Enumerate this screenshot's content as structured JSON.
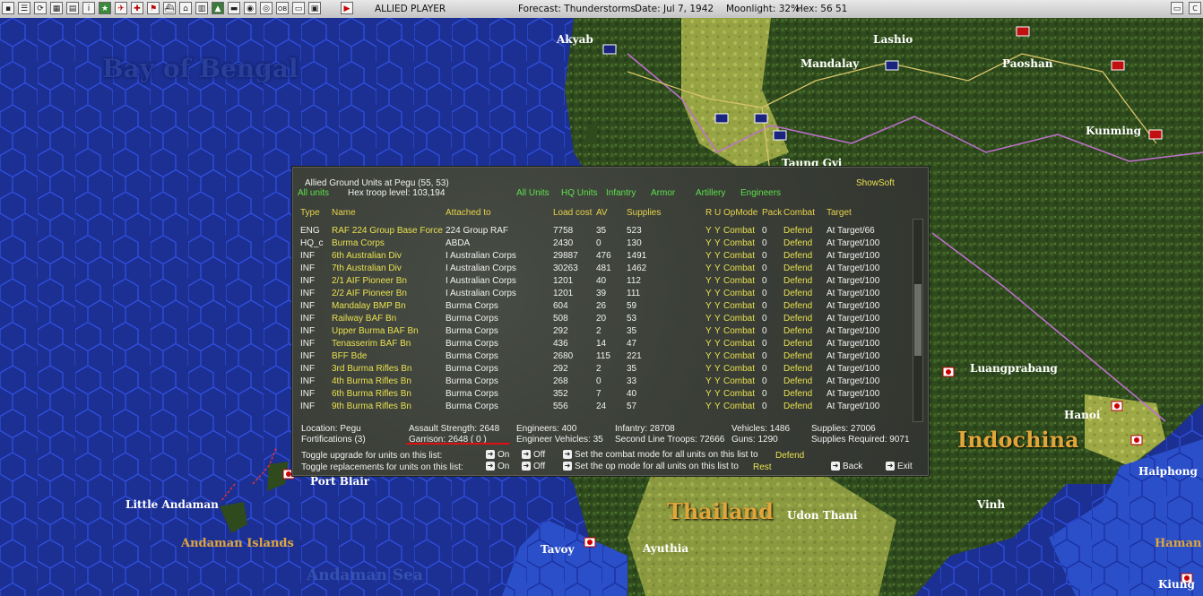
{
  "topbar": {
    "player": "ALLIED PLAYER",
    "forecast": "Forecast: Thunderstorms",
    "date": "Date: Jul 7, 1942",
    "moonlight": "Moonlight: 32%",
    "hex": "Hex: 56 51"
  },
  "map_labels": {
    "bay_of_bengal": "Bay of Bengal",
    "akyab": "Akyab",
    "lashio": "Lashio",
    "mandalay": "Mandalay",
    "paoshan": "Paoshan",
    "kunming": "Kunming",
    "taunggyi": "Taung Gyi",
    "luangprabang": "Luangprabang",
    "hanoi": "Hanoi",
    "indochina": "Indochina",
    "haiphong": "Haiphong",
    "vinh": "Vinh",
    "thailand": "Thailand",
    "udon_thani": "Udon Thani",
    "ayuthia": "Ayuthia",
    "tavoy": "Tavoy",
    "port_blair": "Port Blair",
    "little_andaman": "Little Andaman",
    "andaman_islands": "Andaman Islands",
    "andaman_sea": "Andaman Sea",
    "haman": "Haman",
    "kiung": "Kiung"
  },
  "panel": {
    "title": "Allied Ground Units at Pegu  (55, 53)",
    "all_units_left": "All units",
    "troop_level": "Hex troop level: 103,194",
    "filters": [
      "All Units",
      "HQ Units",
      "Infantry",
      "Armor",
      "Artillery",
      "Engineers"
    ],
    "show_soft": "ShowSoft",
    "columns": {
      "type": "Type",
      "name": "Name",
      "attached": "Attached to",
      "load": "Load cost",
      "av": "AV",
      "supplies": "Supplies",
      "ru": "R U",
      "opmode": "OpMode",
      "pack": "Pack",
      "combat": "Combat",
      "target": "Target"
    },
    "rows": [
      {
        "type": "ENG",
        "name": "RAF 224 Group Base Force",
        "attached": "224 Group RAF",
        "load": "7758",
        "av": "35",
        "supplies": "523",
        "r": "Y",
        "u": "Y",
        "opmode": "Combat",
        "pack": "0",
        "combat": "Defend",
        "target": "At Target/66"
      },
      {
        "type": "HQ_c",
        "name": "Burma Corps",
        "attached": "ABDA",
        "load": "2430",
        "av": "0",
        "supplies": "130",
        "r": "Y",
        "u": "Y",
        "opmode": "Combat",
        "pack": "0",
        "combat": "Defend",
        "target": "At Target/100"
      },
      {
        "type": "INF",
        "name": "6th Australian Div",
        "attached": "I Australian Corps",
        "load": "29887",
        "av": "476",
        "supplies": "1491",
        "r": "Y",
        "u": "Y",
        "opmode": "Combat",
        "pack": "0",
        "combat": "Defend",
        "target": "At Target/100"
      },
      {
        "type": "INF",
        "name": "7th Australian Div",
        "attached": "I Australian Corps",
        "load": "30263",
        "av": "481",
        "supplies": "1462",
        "r": "Y",
        "u": "Y",
        "opmode": "Combat",
        "pack": "0",
        "combat": "Defend",
        "target": "At Target/100"
      },
      {
        "type": "INF",
        "name": "2/1 AIF Pioneer Bn",
        "attached": "I Australian Corps",
        "load": "1201",
        "av": "40",
        "supplies": "112",
        "r": "Y",
        "u": "Y",
        "opmode": "Combat",
        "pack": "0",
        "combat": "Defend",
        "target": "At Target/100"
      },
      {
        "type": "INF",
        "name": "2/2 AIF Pioneer Bn",
        "attached": "I Australian Corps",
        "load": "1201",
        "av": "39",
        "supplies": "111",
        "r": "Y",
        "u": "Y",
        "opmode": "Combat",
        "pack": "0",
        "combat": "Defend",
        "target": "At Target/100"
      },
      {
        "type": "INF",
        "name": "Mandalay BMP Bn",
        "attached": "Burma Corps",
        "load": "604",
        "av": "26",
        "supplies": "59",
        "r": "Y",
        "u": "Y",
        "opmode": "Combat",
        "pack": "0",
        "combat": "Defend",
        "target": "At Target/100"
      },
      {
        "type": "INF",
        "name": "Railway BAF Bn",
        "attached": "Burma Corps",
        "load": "508",
        "av": "20",
        "supplies": "53",
        "r": "Y",
        "u": "Y",
        "opmode": "Combat",
        "pack": "0",
        "combat": "Defend",
        "target": "At Target/100"
      },
      {
        "type": "INF",
        "name": "Upper Burma BAF Bn",
        "attached": "Burma Corps",
        "load": "292",
        "av": "2",
        "supplies": "35",
        "r": "Y",
        "u": "Y",
        "opmode": "Combat",
        "pack": "0",
        "combat": "Defend",
        "target": "At Target/100"
      },
      {
        "type": "INF",
        "name": "Tenasserim BAF Bn",
        "attached": "Burma Corps",
        "load": "436",
        "av": "14",
        "supplies": "47",
        "r": "Y",
        "u": "Y",
        "opmode": "Combat",
        "pack": "0",
        "combat": "Defend",
        "target": "At Target/100"
      },
      {
        "type": "INF",
        "name": "BFF Bde",
        "attached": "Burma Corps",
        "load": "2680",
        "av": "115",
        "supplies": "221",
        "r": "Y",
        "u": "Y",
        "opmode": "Combat",
        "pack": "0",
        "combat": "Defend",
        "target": "At Target/100"
      },
      {
        "type": "INF",
        "name": "3rd Burma Rifles Bn",
        "attached": "Burma Corps",
        "load": "292",
        "av": "2",
        "supplies": "35",
        "r": "Y",
        "u": "Y",
        "opmode": "Combat",
        "pack": "0",
        "combat": "Defend",
        "target": "At Target/100"
      },
      {
        "type": "INF",
        "name": "4th Burma Rifles Bn",
        "attached": "Burma Corps",
        "load": "268",
        "av": "0",
        "supplies": "33",
        "r": "Y",
        "u": "Y",
        "opmode": "Combat",
        "pack": "0",
        "combat": "Defend",
        "target": "At Target/100"
      },
      {
        "type": "INF",
        "name": "6th Burma Rifles Bn",
        "attached": "Burma Corps",
        "load": "352",
        "av": "7",
        "supplies": "40",
        "r": "Y",
        "u": "Y",
        "opmode": "Combat",
        "pack": "0",
        "combat": "Defend",
        "target": "At Target/100"
      },
      {
        "type": "INF",
        "name": "9th Burma Rifles Bn",
        "attached": "Burma Corps",
        "load": "556",
        "av": "24",
        "supplies": "57",
        "r": "Y",
        "u": "Y",
        "opmode": "Combat",
        "pack": "0",
        "combat": "Defend",
        "target": "At Target/100"
      }
    ],
    "footer": {
      "location": "Location: Pegu",
      "fortifications": "Fortifications (3)",
      "assault_strength": "Assault Strength: 2648",
      "garrison": "Garrison: 2648  ( 0 )",
      "engineers": "Engineers: 400",
      "engineer_vehicles": "Engineer Vehicles: 35",
      "infantry": "Infantry: 28708",
      "second_line": "Second Line Troops: 72666",
      "vehicles": "Vehicles: 1486",
      "guns": "Guns: 1290",
      "supplies": "Supplies: 27006",
      "supplies_required": "Supplies Required: 9071",
      "toggle_upgrade": "Toggle upgrade for units on this list:",
      "toggle_replacements": "Toggle replacements for units on this list:",
      "on": "On",
      "off": "Off",
      "set_combat_mode": "Set the combat mode for all units on this list to",
      "combat_mode_value": "Defend",
      "set_op_mode": "Set the op mode for all units on this list to",
      "op_mode_value": "Rest",
      "back": "Back",
      "exit": "Exit"
    }
  }
}
